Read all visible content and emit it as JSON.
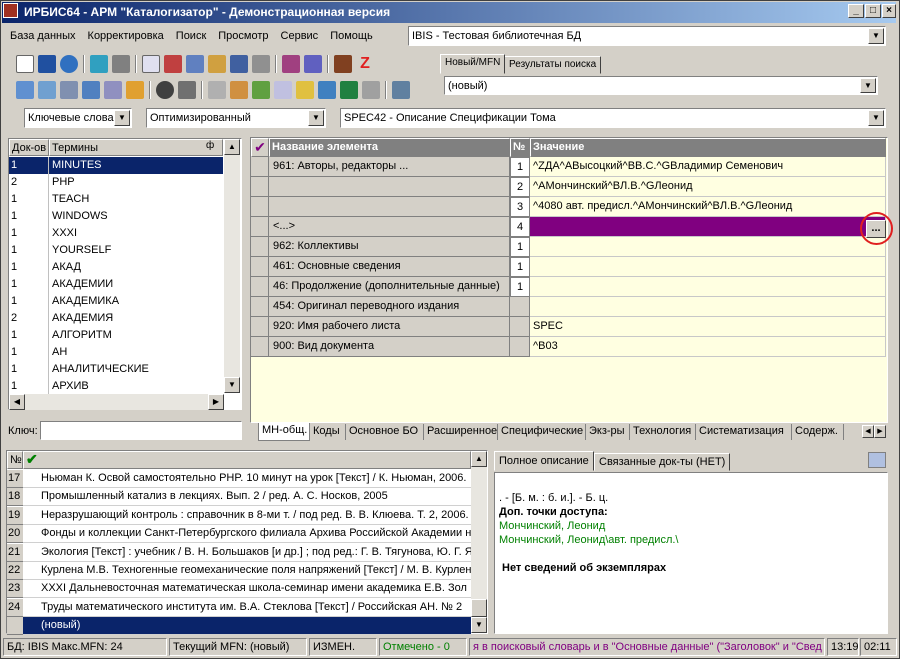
{
  "title": "ИРБИС64 - АРМ \"Каталогизатор\" - Демонстрационная версия",
  "menu": [
    "База данных",
    "Корректировка",
    "Поиск",
    "Просмотр",
    "Сервис",
    "Помощь"
  ],
  "db_combo": "IBIS - Тестовая библиотечная БД",
  "top_tabs": [
    "Новый/MFN",
    "Результаты поиска"
  ],
  "mfn_combo": "(новый)",
  "search": {
    "mode": "Ключевые слова",
    "method": "Оптимизированный",
    "worksheet": "SPEC42 - Описание Спецификации Тома"
  },
  "dict": {
    "col_count": "Док-ов",
    "col_term": "Термины",
    "pin": "ф",
    "rows": [
      {
        "c": "1",
        "t": "MINUTES"
      },
      {
        "c": "2",
        "t": "PHP"
      },
      {
        "c": "1",
        "t": "TEACH"
      },
      {
        "c": "1",
        "t": "WINDOWS"
      },
      {
        "c": "1",
        "t": "XXXI"
      },
      {
        "c": "1",
        "t": "YOURSELF"
      },
      {
        "c": "1",
        "t": "АКАД"
      },
      {
        "c": "1",
        "t": "АКАДЕМИИ"
      },
      {
        "c": "1",
        "t": "АКАДЕМИКА"
      },
      {
        "c": "2",
        "t": "АКАДЕМИЯ"
      },
      {
        "c": "1",
        "t": "АЛГОРИТМ"
      },
      {
        "c": "1",
        "t": "АН"
      },
      {
        "c": "1",
        "t": "АНАЛИТИЧЕСКИЕ"
      },
      {
        "c": "1",
        "t": "АРХИВ"
      }
    ],
    "key_label": "Ключ:"
  },
  "editor": {
    "col_name": "Название элемента",
    "col_no": "№",
    "col_value": "Значение",
    "ellipsis": "...",
    "rows": [
      {
        "name": "961: Авторы, редакторы ...",
        "no": "1",
        "value": "^ZДА^AВысоцкий^BВ.С.^GВладимир Семенович"
      },
      {
        "name": "",
        "no": "2",
        "value": "^AМончинский^BЛ.В.^GЛеонид"
      },
      {
        "name": "",
        "no": "3",
        "value": "^4080 авт. предисл.^AМончинский^BЛ.В.^GЛеонид"
      },
      {
        "name": "<...>",
        "no": "4",
        "value": ""
      },
      {
        "name": "962: Коллективы",
        "no": "1",
        "value": ""
      },
      {
        "name": "461: Основные сведения",
        "no": "1",
        "value": ""
      },
      {
        "name": "46: Продолжение (дополнительные данные)",
        "no": "1",
        "value": ""
      },
      {
        "name": "454: Оригинал переводного издания",
        "no": "",
        "value": ""
      },
      {
        "name": "920: Имя рабочего листа",
        "no": "",
        "value": "SPEC"
      },
      {
        "name": "900: Вид документа",
        "no": "",
        "value": "^B03"
      }
    ],
    "tabs": [
      "МН-общ.",
      "Коды",
      "Основное БО",
      "Расширенное",
      "Специфические",
      "Экз-ры",
      "Технология",
      "Систематизация",
      "Содерж."
    ]
  },
  "list": {
    "col_no": "№",
    "rows": [
      {
        "n": "17",
        "t": "Ньюман К. Освой самостоятельно PHP. 10 минут на урок [Текст] / К. Ньюман, 2006."
      },
      {
        "n": "18",
        "t": "Промышленный катализ в лекциях. Вып. 2 / ред. А. С. Носков, 2005"
      },
      {
        "n": "19",
        "t": "Неразрушающий контроль : справочник в 8-ми т. / под ред. В. В. Клюева. Т. 2, 2006."
      },
      {
        "n": "20",
        "t": "Фонды и коллекции Санкт-Петербургского филиала Архива Российской Академии н"
      },
      {
        "n": "21",
        "t": "Экология [Текст] : учебник / В. Н. Большаков [и др.] ; под ред.: Г. В. Тягунова, Ю. Г. Я"
      },
      {
        "n": "22",
        "t": "Курлена М.В. Техногенные геомеханические поля напряжений [Текст] / М. В. Курлен"
      },
      {
        "n": "23",
        "t": "XXXI Дальневосточная математическая школа-семинар имени академика Е.В. Зол"
      },
      {
        "n": "24",
        "t": "Труды математического института им. В.А. Стеклова [Текст] / Российская АН. № 2"
      },
      {
        "n": "",
        "t": "(новый)"
      }
    ]
  },
  "desc": {
    "tabs": [
      "Полное описание",
      "Связанные док-ты (НЕТ)"
    ],
    "lines": [
      ". - [Б. м. : б. и.]. - Б. ц.",
      "Доп. точки доступа:",
      "Мончинский, Леонид",
      "Мончинский, Леонид\\авт. предисл.\\",
      "Нет сведений об экземплярах"
    ]
  },
  "status": {
    "db": "БД: IBIS Макс.MFN: 24",
    "mfn": "Текущий MFN: (новый)",
    "changed": "ИЗМЕН.",
    "marked": "Отмечено - 0",
    "hint": "я в поисковый словарь и в \"Основные данные\" (\"Заголовок\" и \"Свед",
    "time1": "13:19",
    "time2": "02:11"
  },
  "colors": {
    "accent": "#0a246a",
    "editor_sel": "#800080",
    "green": "#008000",
    "purple": "#800080"
  }
}
